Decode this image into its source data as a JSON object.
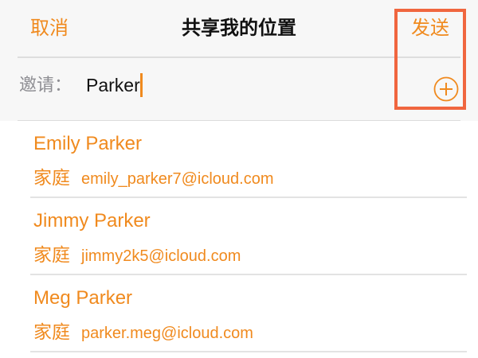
{
  "nav": {
    "cancel_label": "取消",
    "title": "共享我的位置",
    "send_label": "发送"
  },
  "invite": {
    "label": "邀请：",
    "value": "Parker",
    "add_icon": "plus-circle-icon"
  },
  "contacts": [
    {
      "name": "Emily Parker",
      "type": "家庭",
      "email": "emily_parker7@icloud.com"
    },
    {
      "name": "Jimmy Parker",
      "type": "家庭",
      "email": "jimmy2k5@icloud.com"
    },
    {
      "name": "Meg Parker",
      "type": "家庭",
      "email": "parker.meg@icloud.com"
    }
  ],
  "colors": {
    "accent": "#f08a1e",
    "highlight": "#f0663f",
    "header_bg": "#f7f7f7",
    "label_gray": "#8e8e93"
  }
}
